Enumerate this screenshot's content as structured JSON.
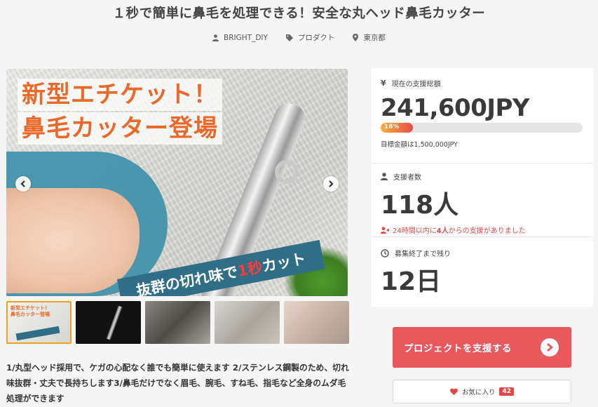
{
  "project": {
    "title": "１秒で簡単に鼻毛を処理できる！安全な丸ヘッド鼻毛カッター",
    "owner": "BRIGHT_DIY",
    "category": "プロダクト",
    "location": "東京都"
  },
  "hero": {
    "headline_1": "新型エチケット！",
    "headline_2": "鼻毛カッター登場",
    "banner_pre": "抜群の切れ味で",
    "banner_hot": "1秒",
    "banner_post": "カット"
  },
  "thumbnails": [
    {
      "name": "thumb-1",
      "active": true,
      "mini_1": "新型エチケット！",
      "mini_2": "鼻毛カッター登場"
    },
    {
      "name": "thumb-2",
      "active": false
    },
    {
      "name": "thumb-3",
      "active": false
    },
    {
      "name": "thumb-4",
      "active": false
    },
    {
      "name": "thumb-5",
      "active": false
    }
  ],
  "description": "1/丸型ヘッド採用で、ケガの心配なく誰でも簡単に使えます 2/ステンレス鋼製のため、切れ味抜群・丈夫で長持ちします3/鼻毛だけでなく眉毛、腕毛、すね毛、指毛など全身のムダ毛処理ができます",
  "funding": {
    "total_label": "現在の支援総額",
    "total_amount": "241,600JPY",
    "progress_percent": 16,
    "progress_label": "16%",
    "goal_text": "目標金額は1,500,000JPY"
  },
  "backers": {
    "label": "支援者数",
    "count": "118人",
    "note_pre": "24時間以内に",
    "note_num": "4人",
    "note_post": "からの支援がありました"
  },
  "remaining": {
    "label": "募集終了まで残り",
    "value": "12日"
  },
  "actions": {
    "support_label": "プロジェクトを支援する",
    "favorite_label": "お気に入り",
    "favorite_count": "42"
  },
  "colors": {
    "accent": "#e8585d",
    "progress_start": "#f7b13a",
    "progress_end": "#e94a4a",
    "alert": "#e04848"
  },
  "icons": {
    "owner": "user-icon",
    "category": "tag-icon",
    "location": "map-pin-icon",
    "total": "yen-icon",
    "backers": "user-icon",
    "recent": "user-plus-icon",
    "remaining": "clock-icon",
    "support": "chevron-right-circle-icon",
    "favorite": "heart-icon"
  }
}
